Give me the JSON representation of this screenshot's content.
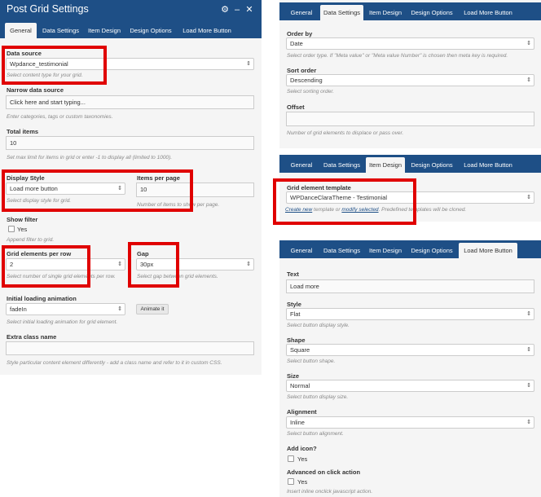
{
  "left": {
    "title": "Post Grid Settings",
    "tabs": [
      "General",
      "Data Settings",
      "Item Design",
      "Design Options",
      "Load More Button"
    ],
    "data_source": {
      "label": "Data source",
      "value": "Wpdance_testimonial",
      "desc": "Select content type for your grid."
    },
    "narrow": {
      "label": "Narrow data source",
      "placeholder": "Click here and start typing...",
      "desc": "Enter categories, tags or custom taxonomies."
    },
    "total": {
      "label": "Total items",
      "value": "10",
      "desc": "Set max limit for items in grid or enter -1 to display all (limited to 1000)."
    },
    "display_style": {
      "label": "Display Style",
      "value": "Load more button",
      "desc": "Select display style for grid."
    },
    "per_page": {
      "label": "Items per page",
      "value": "10",
      "desc": "Number of items to show per page."
    },
    "show_filter": {
      "label": "Show filter",
      "option": "Yes",
      "desc": "Append filter to grid."
    },
    "per_row": {
      "label": "Grid elements per row",
      "value": "2",
      "desc": "Select number of single grid elements per row."
    },
    "gap": {
      "label": "Gap",
      "value": "30px",
      "desc": "Select gap between grid elements."
    },
    "anim": {
      "label": "Initial loading animation",
      "value": "fadeIn",
      "button": "Animate it",
      "desc": "Select initial loading animation for grid element."
    },
    "extra": {
      "label": "Extra class name",
      "desc": "Style particular content element differently - add a class name and refer to it in custom CSS."
    }
  },
  "p1": {
    "tabs": [
      "General",
      "Data Settings",
      "Item Design",
      "Design Options",
      "Load More Button"
    ],
    "order_by": {
      "label": "Order by",
      "value": "Date",
      "desc": "Select order type. If \"Meta value\" or \"Meta value Number\" is chosen then meta key is required."
    },
    "sort_order": {
      "label": "Sort order",
      "value": "Descending",
      "desc": "Select sorting order."
    },
    "offset": {
      "label": "Offset",
      "desc": "Number of grid elements to displace or pass over."
    }
  },
  "p2": {
    "tabs": [
      "General",
      "Data Settings",
      "Item Design",
      "Design Options",
      "Load More Button"
    ],
    "template": {
      "label": "Grid element template",
      "value": "WPDanceClaraTheme - Testimonial",
      "desc_create": "Create new",
      "desc_mid": " template or ",
      "desc_modify": "modify selected",
      "desc_end": ". Predefined templates will be cloned."
    }
  },
  "p3": {
    "tabs": [
      "General",
      "Data Settings",
      "Item Design",
      "Design Options",
      "Load More Button"
    ],
    "text": {
      "label": "Text",
      "value": "Load more"
    },
    "style": {
      "label": "Style",
      "value": "Flat",
      "desc": "Select button display style."
    },
    "shape": {
      "label": "Shape",
      "value": "Square",
      "desc": "Select button shape."
    },
    "size": {
      "label": "Size",
      "value": "Normal",
      "desc": "Select button display size."
    },
    "alignment": {
      "label": "Alignment",
      "value": "Inline",
      "desc": "Select button alignment."
    },
    "add_icon": {
      "label": "Add icon?",
      "option": "Yes"
    },
    "advanced": {
      "label": "Advanced on click action",
      "option": "Yes",
      "desc": "Insert inline onclick javascript action."
    }
  },
  "colors": {
    "header": "#1e4f86",
    "highlight": "#e00000",
    "panel": "#f5f5f5"
  }
}
